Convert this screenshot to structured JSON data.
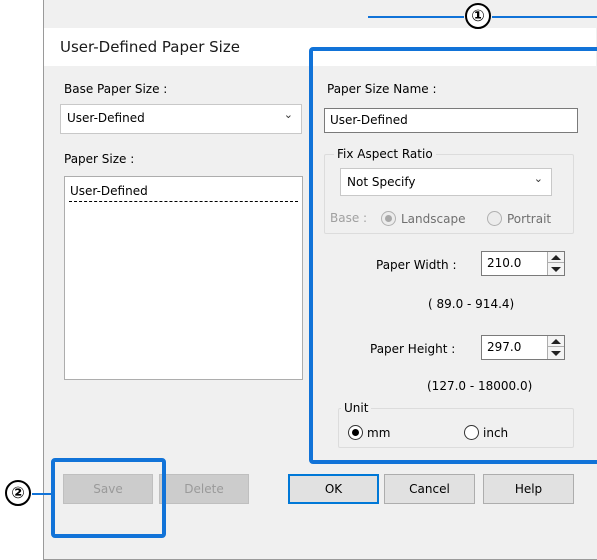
{
  "dialog": {
    "title": "User-Defined Paper Size"
  },
  "left": {
    "base_paper_size_label": "Base Paper Size :",
    "base_paper_size_value": "User-Defined",
    "paper_size_label": "Paper Size :",
    "paper_size_items": [
      "User-Defined"
    ]
  },
  "right": {
    "paper_size_name_label": "Paper Size Name :",
    "paper_size_name_value": "User-Defined",
    "fix_aspect_ratio_label": "Fix Aspect Ratio",
    "fix_aspect_ratio_value": "Not Specify",
    "base_label": "Base :",
    "landscape_label": "Landscape",
    "portrait_label": "Portrait",
    "paper_width_label": "Paper Width  :",
    "paper_width_value": "210.0",
    "paper_width_range": "( 89.0 - 914.4)",
    "paper_height_label": "Paper Height :",
    "paper_height_value": "297.0",
    "paper_height_range": "(127.0 - 18000.0)",
    "unit_label": "Unit",
    "unit_mm": "mm",
    "unit_inch": "inch",
    "unit_selected": "mm"
  },
  "buttons": {
    "save": "Save",
    "delete": "Delete",
    "ok": "OK",
    "cancel": "Cancel",
    "help": "Help"
  },
  "callouts": {
    "one": "①",
    "two": "②"
  },
  "colors": {
    "callout": "#1173d8",
    "default_button_border": "#0078d7"
  }
}
